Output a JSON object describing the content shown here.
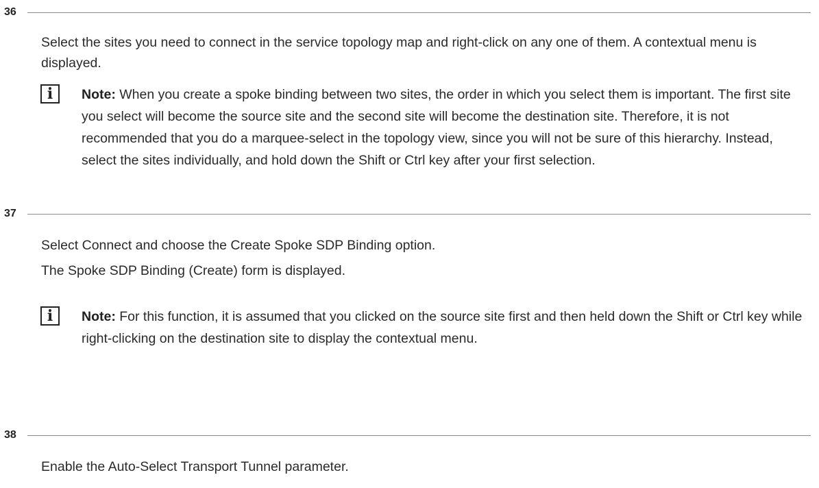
{
  "steps": [
    {
      "number": "36",
      "text": "Select the sites you need to connect in the service topology map and right-click on any one of them. A contextual menu is displayed.",
      "note": {
        "icon": "info-icon",
        "label": "Note:",
        "text": " When you create a spoke binding between two sites, the order in which you select them is important. The first site you select will become the source site and the second site will become the destination site. Therefore, it is not recommended that you do a marquee-select in the topology view, since you will not be sure of this hierarchy. Instead, select the sites individually, and hold down the Shift or Ctrl key after your first selection."
      }
    },
    {
      "number": "37",
      "text": "Select Connect and choose the Create Spoke SDP Binding option.",
      "text2": "The Spoke SDP Binding (Create) form is displayed.",
      "note": {
        "icon": "info-icon",
        "label": "Note:",
        "text": " For this function, it is assumed that you clicked on the source site first and then held down the Shift or Ctrl key while right-clicking on the destination site to display the contextual menu."
      }
    },
    {
      "number": "38",
      "text": "Enable the Auto-Select Transport Tunnel parameter."
    }
  ]
}
